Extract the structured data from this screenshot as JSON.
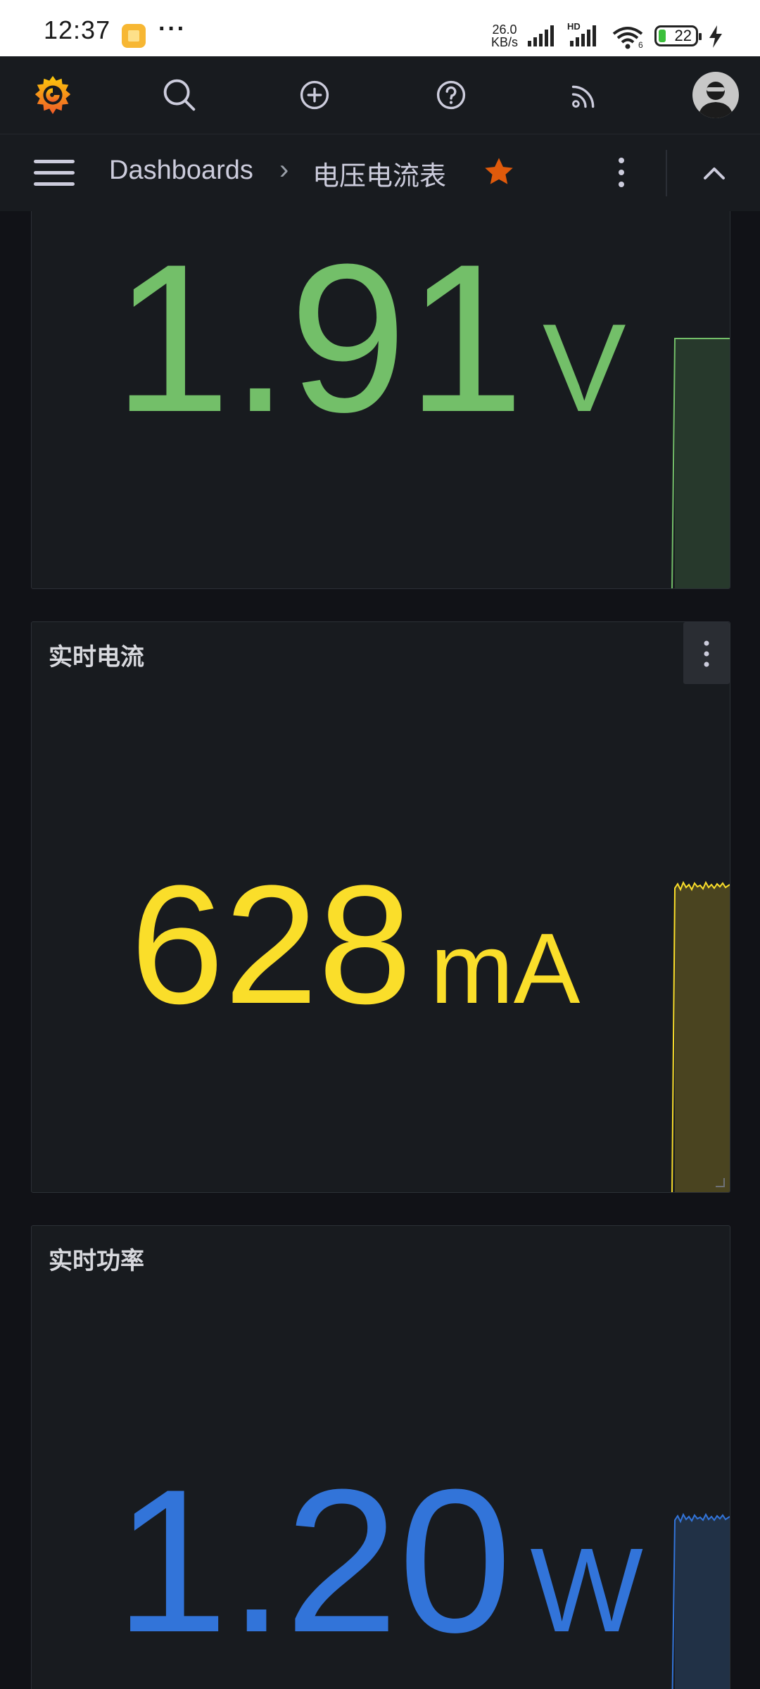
{
  "status_bar": {
    "time": "12:37",
    "more": "···",
    "net_speed_value": "26.0",
    "net_speed_unit": "KB/s",
    "network_label": "HD",
    "wifi_label": "6",
    "battery": "22"
  },
  "breadcrumb": {
    "root": "Dashboards",
    "separator": "›",
    "current": "电压电流表"
  },
  "panels": [
    {
      "title": "",
      "value": "1.91",
      "unit": "V",
      "color": "#73bf69",
      "fill": "#27392c"
    },
    {
      "title": "实时电流",
      "value": "628",
      "unit": "mA",
      "color": "#fade2a",
      "fill": "#4a4420"
    },
    {
      "title": "实时功率",
      "value": "1.20",
      "unit": "W",
      "color": "#3274d9",
      "fill": "#213146"
    }
  ],
  "colors": {
    "background": "#111217",
    "panel": "#181b1f",
    "star": "#e05a0b",
    "text": "#ccccdc"
  }
}
